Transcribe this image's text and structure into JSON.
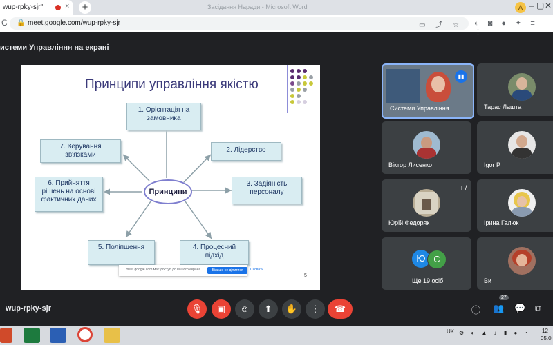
{
  "browser": {
    "tab_title": "wup-rpky-sjr\"",
    "tab_close": "×",
    "new_tab": "+",
    "window_title": "Засідання Наради - Microsoft Word",
    "controls": {
      "minimize": "–",
      "restore": "▢",
      "close": "✕"
    },
    "profile_initial": "A",
    "reload_glyph": "C",
    "lock_glyph": "🔒",
    "url": "meet.google.com/wup-rpky-sjr",
    "omni_icons": "▭ ⤴ ☆",
    "ext_icons": "◐ ◙ ● ✦ ≡ ⋮"
  },
  "meet": {
    "presenting_label": "истеми Управління на екрані",
    "meeting_code": "wup-rpky-sjr",
    "participant_count": "27",
    "others_label": "Ще 19 осіб"
  },
  "slide": {
    "title": "Принципи управління якістю",
    "center": "Принципи",
    "boxes": [
      {
        "line1": "1. Орієнтація на",
        "line2": "замовника"
      },
      {
        "line1": "2. Лідерство",
        "line2": ""
      },
      {
        "line1": "3. Задіяність",
        "line2": "персоналу"
      },
      {
        "line1": "4. Процесний",
        "line2": "підхід"
      },
      {
        "line1": "5. Поліпшення",
        "line2": ""
      },
      {
        "line1": "6. Прийняття",
        "line2": "рішень на основі",
        "line3": "фактичних даних"
      },
      {
        "line1": "7. Керування",
        "line2": "зв'язками"
      }
    ],
    "page_number": "5",
    "share_notice": {
      "text": "meet.google.com має доступ до вашого екрана.",
      "button": "Більше не ділитися",
      "hide": "Сховати"
    }
  },
  "participants": [
    {
      "name": "Системи Управління",
      "speaking": true
    },
    {
      "name": "Тарас Лашта"
    },
    {
      "name": "Віктор Лисенко"
    },
    {
      "name": "Igor P"
    },
    {
      "name": "Юрій Федоряк",
      "muted": true
    },
    {
      "name": "Ірина Галюк"
    },
    {
      "name": "Ви"
    }
  ],
  "other_avatars": [
    {
      "initial": "Ю",
      "color": "#1e88e5"
    },
    {
      "initial": "C",
      "color": "#43a047"
    }
  ],
  "taskbar": {
    "lang": "UK",
    "time": "12",
    "date": "05.0"
  },
  "colors": {
    "meet_bg": "#202124",
    "tile_bg": "#3c4043",
    "leave": "#ea4335",
    "accent": "#1a73e8"
  }
}
